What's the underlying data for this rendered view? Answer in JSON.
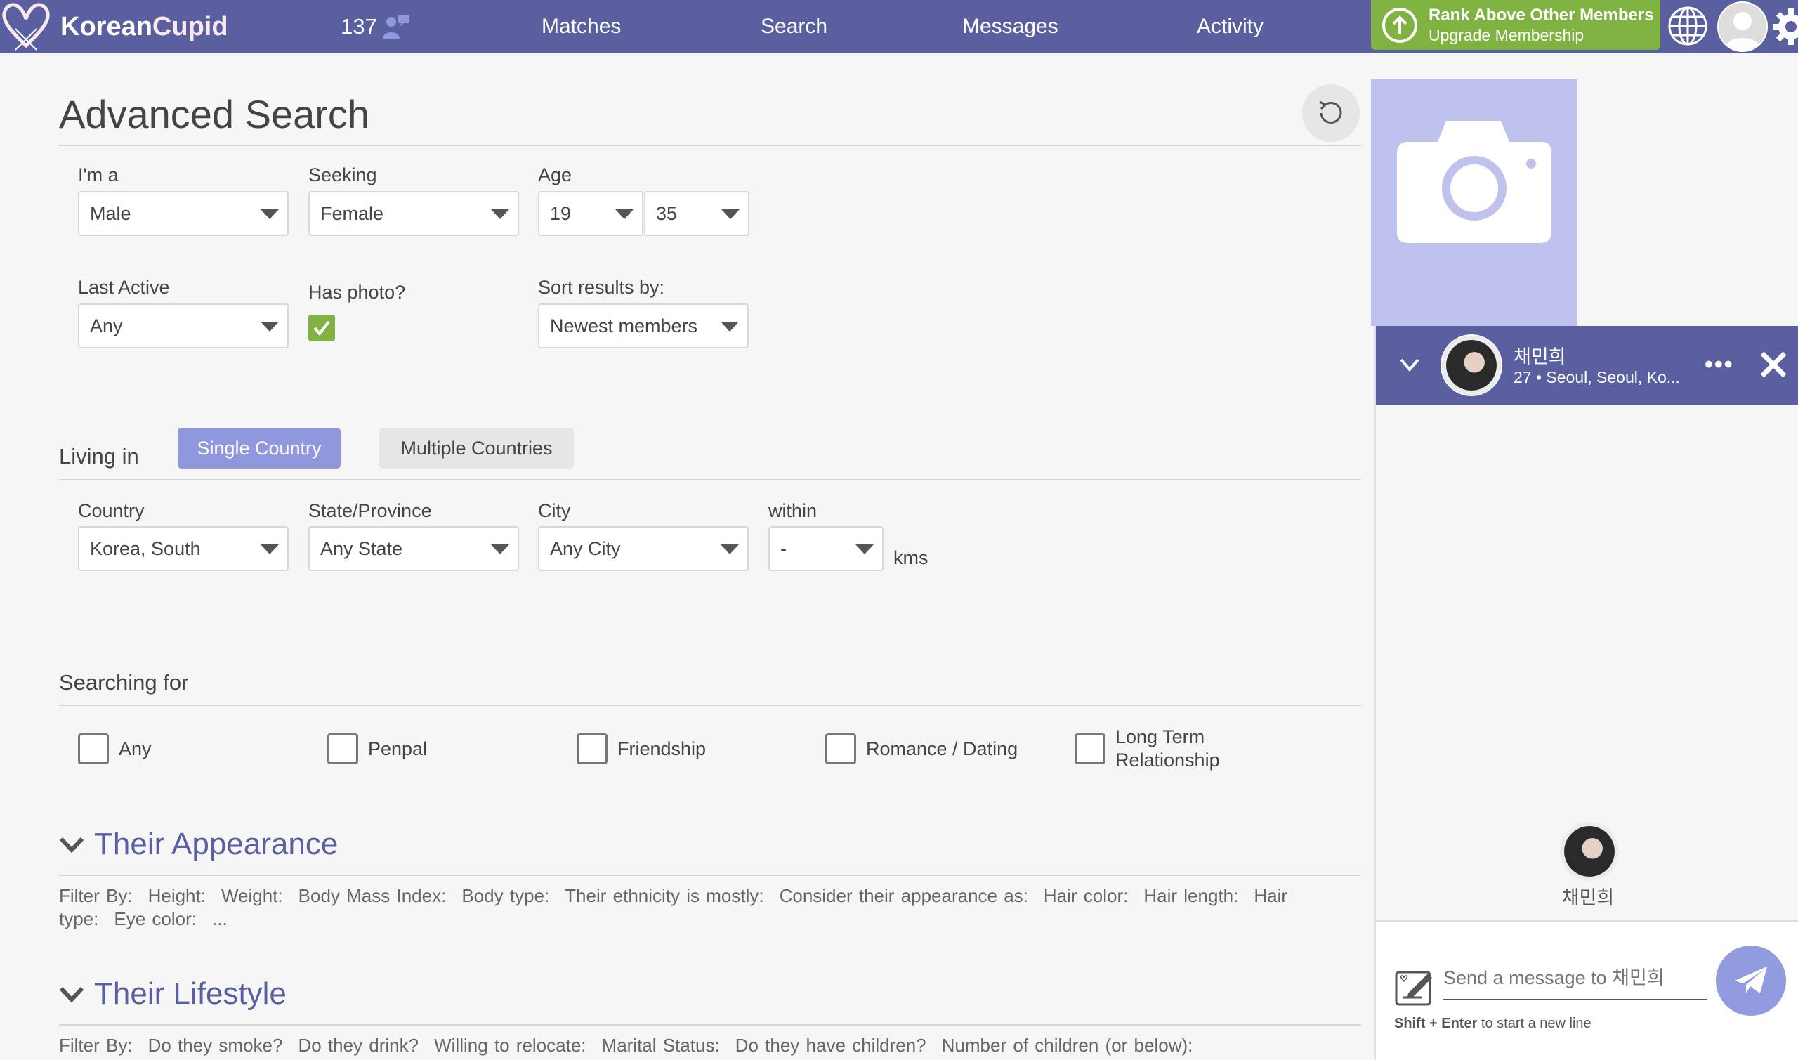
{
  "topbar": {
    "brand_main": "Korean",
    "brand_accent": "Cupid",
    "online_count": "137",
    "nav": [
      {
        "label": "Matches"
      },
      {
        "label": "Search"
      },
      {
        "label": "Messages"
      },
      {
        "label": "Activity"
      }
    ],
    "upgrade_title": "Rank Above Other Members",
    "upgrade_subtitle": "Upgrade Membership",
    "icons": [
      "logo-heart-icon",
      "online-users-icon",
      "arrow-up-circle-icon",
      "globe-icon",
      "user-avatar-icon",
      "gear-icon"
    ]
  },
  "search": {
    "title": "Advanced Search",
    "im_a": {
      "label": "I'm a",
      "value": "Male"
    },
    "seeking": {
      "label": "Seeking",
      "value": "Female"
    },
    "age": {
      "label": "Age",
      "min": "19",
      "max": "35"
    },
    "last_active": {
      "label": "Last Active",
      "value": "Any"
    },
    "has_photo": {
      "label": "Has photo?",
      "checked": true
    },
    "sort": {
      "label": "Sort results by:",
      "value": "Newest members"
    },
    "living_in": {
      "label": "Living in",
      "toggle_single": "Single Country",
      "toggle_multiple": "Multiple Countries",
      "active": "Single Country"
    },
    "country": {
      "label": "Country",
      "value": "Korea, South"
    },
    "state": {
      "label": "State/Province",
      "value": "Any State"
    },
    "city": {
      "label": "City",
      "value": "Any City"
    },
    "within": {
      "label": "within",
      "value": "-",
      "unit": "kms"
    },
    "searching_for": {
      "label": "Searching for",
      "options": [
        {
          "label": "Any",
          "checked": false
        },
        {
          "label": "Penpal",
          "checked": false
        },
        {
          "label": "Friendship",
          "checked": false
        },
        {
          "label": "Romance / Dating",
          "checked": false
        },
        {
          "label": "Long Term Relationship",
          "checked": false
        }
      ]
    },
    "appearance": {
      "title": "Their Appearance",
      "filters": [
        "Filter By:",
        "Height:",
        "Weight:",
        "Body Mass Index:",
        "Body type:",
        "Their ethnicity is mostly:",
        "Consider their appearance as:",
        "Hair color:",
        "Hair length:",
        "Hair type:",
        "Eye color:",
        "..."
      ]
    },
    "lifestyle": {
      "title": "Their Lifestyle",
      "filters": [
        "Filter By:",
        "Do they smoke?",
        "Do they drink?",
        "Willing to relocate:",
        "Marital Status:",
        "Do they have children?",
        "Number of children (or below):"
      ]
    }
  },
  "chat": {
    "name": "채민희",
    "info": "27 • Seoul, Seoul, Ko...",
    "more_label": "•••",
    "placeholder": "Send a message to 채민희",
    "hint_bold": "Shift + Enter",
    "hint_rest": " to start a new line"
  },
  "colors": {
    "brand": "#5a5fa0",
    "accent": "#9197dc",
    "upgrade_green": "#7fb241"
  }
}
